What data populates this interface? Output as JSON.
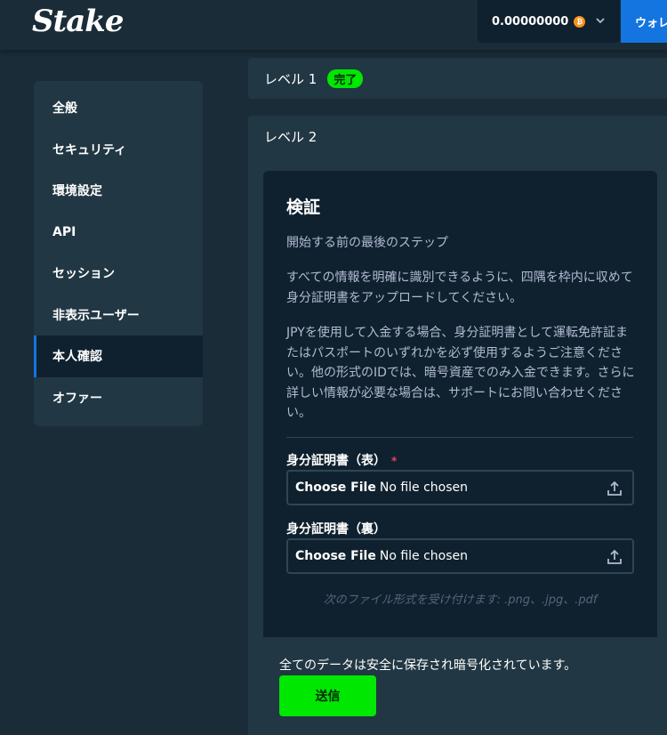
{
  "header": {
    "logo": "Stake",
    "balance": "0.00000000",
    "currency_icon": "bitcoin-icon",
    "wallet_label": "ウォレット"
  },
  "sidebar": {
    "items": [
      {
        "label": "全般"
      },
      {
        "label": "セキュリティ"
      },
      {
        "label": "環境設定"
      },
      {
        "label": "API"
      },
      {
        "label": "セッション"
      },
      {
        "label": "非表示ユーザー"
      },
      {
        "label": "本人確認"
      },
      {
        "label": "オファー"
      }
    ],
    "active_index": 6
  },
  "levels": {
    "level1": {
      "label": "レベル 1",
      "badge": "完了"
    },
    "level2": {
      "label": "レベル 2"
    }
  },
  "verify": {
    "title": "検証",
    "subtitle": "開始する前の最後のステップ",
    "instruction": "すべての情報を明確に識別できるように、四隅を枠内に収めて身分証明書をアップロードしてください。",
    "jpy_note": "JPYを使用して入金する場合、身分証明書として運転免許証またはパスポートのいずれかを必ず使用するようご注意ください。他の形式のIDでは、暗号資産でのみ入金できます。さらに詳しい情報が必要な場合は、サポートにお問い合わせください。",
    "front_label": "身分証明書（表）",
    "required_mark": "*",
    "back_label": "身分証明書（裏）",
    "choose_file": "Choose File",
    "no_file": "No file chosen",
    "accepted_formats": "次のファイル形式を受け付けます: .png、.jpg、.pdf",
    "secure_text": "全てのデータは安全に保存され暗号化されています。",
    "submit_label": "送信"
  },
  "colors": {
    "bg": "#1a2c38",
    "panel": "#213743",
    "dark": "#0f212e",
    "accent_green": "#00e701",
    "accent_blue": "#1475e1"
  }
}
